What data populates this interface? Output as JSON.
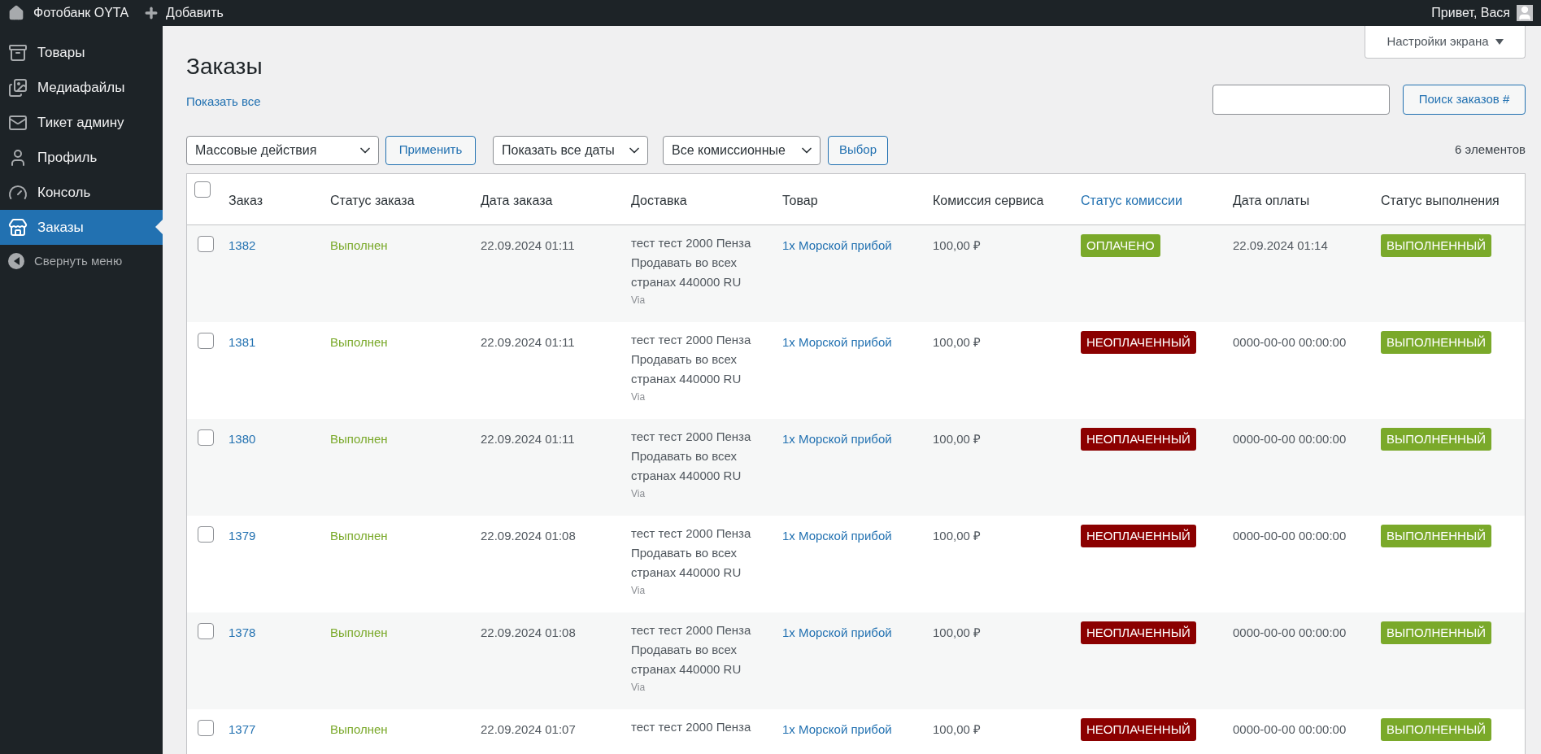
{
  "topbar": {
    "site": "Фотобанк OYTA",
    "add": "Добавить",
    "greeting": "Привет, Вася"
  },
  "sidebar": {
    "items": [
      {
        "label": "Товары",
        "selected": false
      },
      {
        "label": "Медиафайлы",
        "selected": false
      },
      {
        "label": "Тикет админу",
        "selected": false
      },
      {
        "label": "Профиль",
        "selected": false
      },
      {
        "label": "Консоль",
        "selected": false
      },
      {
        "label": "Заказы",
        "selected": true
      }
    ],
    "collapse": "Свернуть меню"
  },
  "screen_options": "Настройки экрана",
  "page_title": "Заказы",
  "show_all": "Показать все",
  "search": {
    "button": "Поиск заказов #"
  },
  "filters": {
    "bulk": "Массовые действия",
    "apply": "Применить",
    "dates": "Показать все даты",
    "commissions": "Все комиссионные",
    "select": "Выбор"
  },
  "count": "6 элементов",
  "table": {
    "select_all_checked": false,
    "columns": [
      {
        "label": "Заказ",
        "sortable": false
      },
      {
        "label": "Статус заказа",
        "sortable": false
      },
      {
        "label": "Дата заказа",
        "sortable": false
      },
      {
        "label": "Доставка",
        "sortable": false
      },
      {
        "label": "Товар",
        "sortable": false
      },
      {
        "label": "Комиссия сервиса",
        "sortable": false
      },
      {
        "label": "Статус комиссии",
        "sortable": true
      },
      {
        "label": "Дата оплаты",
        "sortable": false
      },
      {
        "label": "Статус выполнения",
        "sortable": false
      }
    ],
    "rows": [
      {
        "checked": false,
        "order": "1382",
        "status": "Выполнен",
        "date": "22.09.2024 01:11",
        "delivery": "тест тест 2000 Пенза Продавать во всех странах 440000 RU",
        "via": "Via",
        "product": "1x Морской прибой",
        "commission": "100,00 ₽",
        "commission_status": {
          "text": "ОПЛАЧЕНО",
          "color": "#7aa92a"
        },
        "paid_date": "22.09.2024 01:14",
        "fulfillment": {
          "text": "ВЫПОЛНЕННЫЙ",
          "color": "#7aa92a"
        }
      },
      {
        "checked": false,
        "order": "1381",
        "status": "Выполнен",
        "date": "22.09.2024 01:11",
        "delivery": "тест тест 2000 Пенза Продавать во всех странах 440000 RU",
        "via": "Via",
        "product": "1x Морской прибой",
        "commission": "100,00 ₽",
        "commission_status": {
          "text": "НЕОПЛАЧЕННЫЙ",
          "color": "#8b0000"
        },
        "paid_date": "0000-00-00 00:00:00",
        "fulfillment": {
          "text": "ВЫПОЛНЕННЫЙ",
          "color": "#7aa92a"
        }
      },
      {
        "checked": false,
        "order": "1380",
        "status": "Выполнен",
        "date": "22.09.2024 01:11",
        "delivery": "тест тест 2000 Пенза Продавать во всех странах 440000 RU",
        "via": "Via",
        "product": "1x Морской прибой",
        "commission": "100,00 ₽",
        "commission_status": {
          "text": "НЕОПЛАЧЕННЫЙ",
          "color": "#8b0000"
        },
        "paid_date": "0000-00-00 00:00:00",
        "fulfillment": {
          "text": "ВЫПОЛНЕННЫЙ",
          "color": "#7aa92a"
        }
      },
      {
        "checked": false,
        "order": "1379",
        "status": "Выполнен",
        "date": "22.09.2024 01:08",
        "delivery": "тест тест 2000 Пенза Продавать во всех странах 440000 RU",
        "via": "Via",
        "product": "1x Морской прибой",
        "commission": "100,00 ₽",
        "commission_status": {
          "text": "НЕОПЛАЧЕННЫЙ",
          "color": "#8b0000"
        },
        "paid_date": "0000-00-00 00:00:00",
        "fulfillment": {
          "text": "ВЫПОЛНЕННЫЙ",
          "color": "#7aa92a"
        }
      },
      {
        "checked": false,
        "order": "1378",
        "status": "Выполнен",
        "date": "22.09.2024 01:08",
        "delivery": "тест тест 2000 Пенза Продавать во всех странах 440000 RU",
        "via": "Via",
        "product": "1x Морской прибой",
        "commission": "100,00 ₽",
        "commission_status": {
          "text": "НЕОПЛАЧЕННЫЙ",
          "color": "#8b0000"
        },
        "paid_date": "0000-00-00 00:00:00",
        "fulfillment": {
          "text": "ВЫПОЛНЕННЫЙ",
          "color": "#7aa92a"
        }
      },
      {
        "checked": false,
        "order": "1377",
        "status": "Выполнен",
        "date": "22.09.2024 01:07",
        "delivery": "тест тест 2000 Пенза",
        "product": "1x Морской прибой",
        "commission": "100,00 ₽",
        "commission_status": {
          "text": "НЕОПЛАЧЕННЫЙ",
          "color": "#8b0000"
        },
        "paid_date": "0000-00-00 00:00:00",
        "fulfillment": {
          "text": "ВЫПОЛНЕННЫЙ",
          "color": "#7aa92a"
        }
      }
    ]
  }
}
